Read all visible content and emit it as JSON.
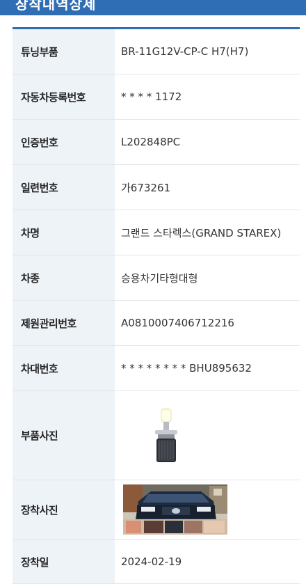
{
  "header": {
    "title": "장착내역상세"
  },
  "rows": [
    {
      "label": "튜닝부품",
      "value": "BR-11G12V-CP-C H7(H7)"
    },
    {
      "label": "자동차등록번호",
      "value": "* * * * 1172"
    },
    {
      "label": "인증번호",
      "value": "L202848PC"
    },
    {
      "label": "일련번호",
      "value": "가673261"
    },
    {
      "label": "차명",
      "value": "그랜드 스타렉스(GRAND STAREX)"
    },
    {
      "label": "차종",
      "value": "승용차기타형대형"
    },
    {
      "label": "제원관리번호",
      "value": "A0810007406712216"
    },
    {
      "label": "차대번호",
      "value": "* * * * * * * * BHU895632"
    },
    {
      "label": "부품사진",
      "image": "led-headlight-bulb-photo"
    },
    {
      "label": "장착사진",
      "image": "installed-vehicle-photo"
    },
    {
      "label": "장착일",
      "value": "2024-02-19"
    }
  ],
  "colors": {
    "accent": "#2f6db5",
    "label_bg": "#eef3f8",
    "border": "#e2e5ea"
  }
}
